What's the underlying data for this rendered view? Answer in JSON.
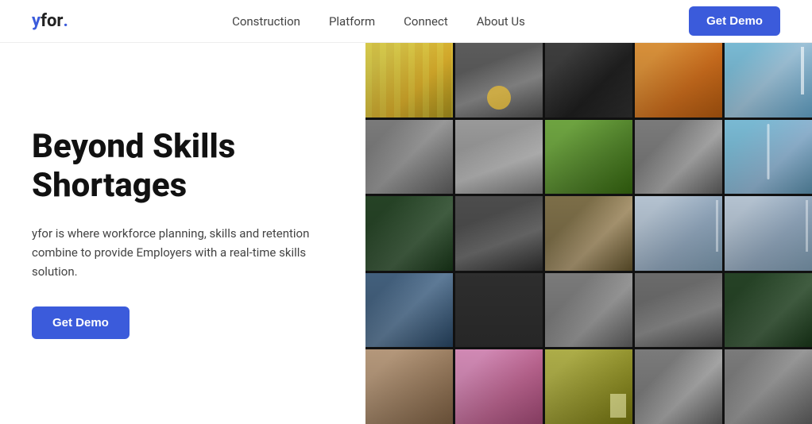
{
  "header": {
    "logo_y": "y",
    "logo_for": "for",
    "logo_dot": ".",
    "nav": {
      "items": [
        {
          "id": "construction",
          "label": "Construction"
        },
        {
          "id": "platform",
          "label": "Platform"
        },
        {
          "id": "connect",
          "label": "Connect"
        },
        {
          "id": "about-us",
          "label": "About Us"
        }
      ]
    },
    "cta_label": "Get Demo"
  },
  "hero": {
    "title": "Beyond Skills Shortages",
    "description": "yfor is where workforce planning, skills and retention combine to provide Employers with a real-time skills solution.",
    "cta_label": "Get Demo"
  },
  "grid": {
    "cells": 25
  }
}
